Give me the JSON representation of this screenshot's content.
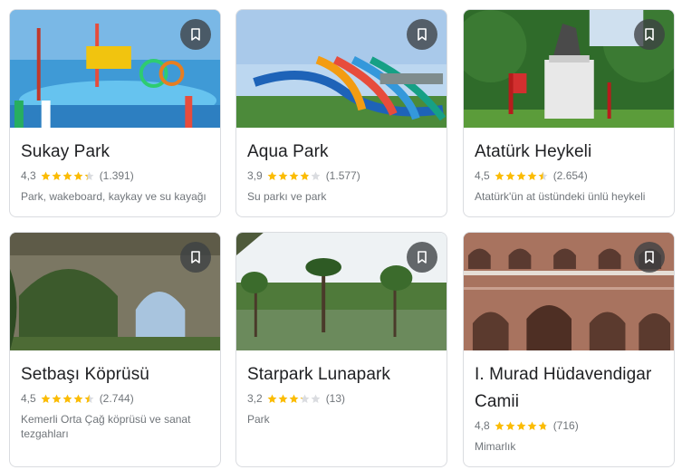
{
  "colors": {
    "star_filled": "#fbbc04",
    "star_empty": "#dadce0",
    "save_bg": "#3c4043"
  },
  "cards": [
    {
      "name": "Sukay Park",
      "rating": "4,3",
      "stars": 4.3,
      "reviews": "(1.391)",
      "description": "Park, wakeboard, kaykay ve su kayağı"
    },
    {
      "name": "Aqua Park",
      "rating": "3,9",
      "stars": 3.9,
      "reviews": "(1.577)",
      "description": "Su parkı ve park"
    },
    {
      "name": "Atatürk Heykeli",
      "rating": "4,5",
      "stars": 4.5,
      "reviews": "(2.654)",
      "description": "Atatürk'ün at üstündeki ünlü heykeli"
    },
    {
      "name": "Setbaşı Köprüsü",
      "rating": "4,5",
      "stars": 4.5,
      "reviews": "(2.744)",
      "description": "Kemerli Orta Çağ köprüsü ve sanat tezgahları"
    },
    {
      "name": "Starpark Lunapark",
      "rating": "3,2",
      "stars": 3.2,
      "reviews": "(13)",
      "description": "Park"
    },
    {
      "name": "I. Murad Hüdavendigar Camii",
      "rating": "4,8",
      "stars": 4.8,
      "reviews": "(716)",
      "description": "Mimarlık"
    }
  ]
}
